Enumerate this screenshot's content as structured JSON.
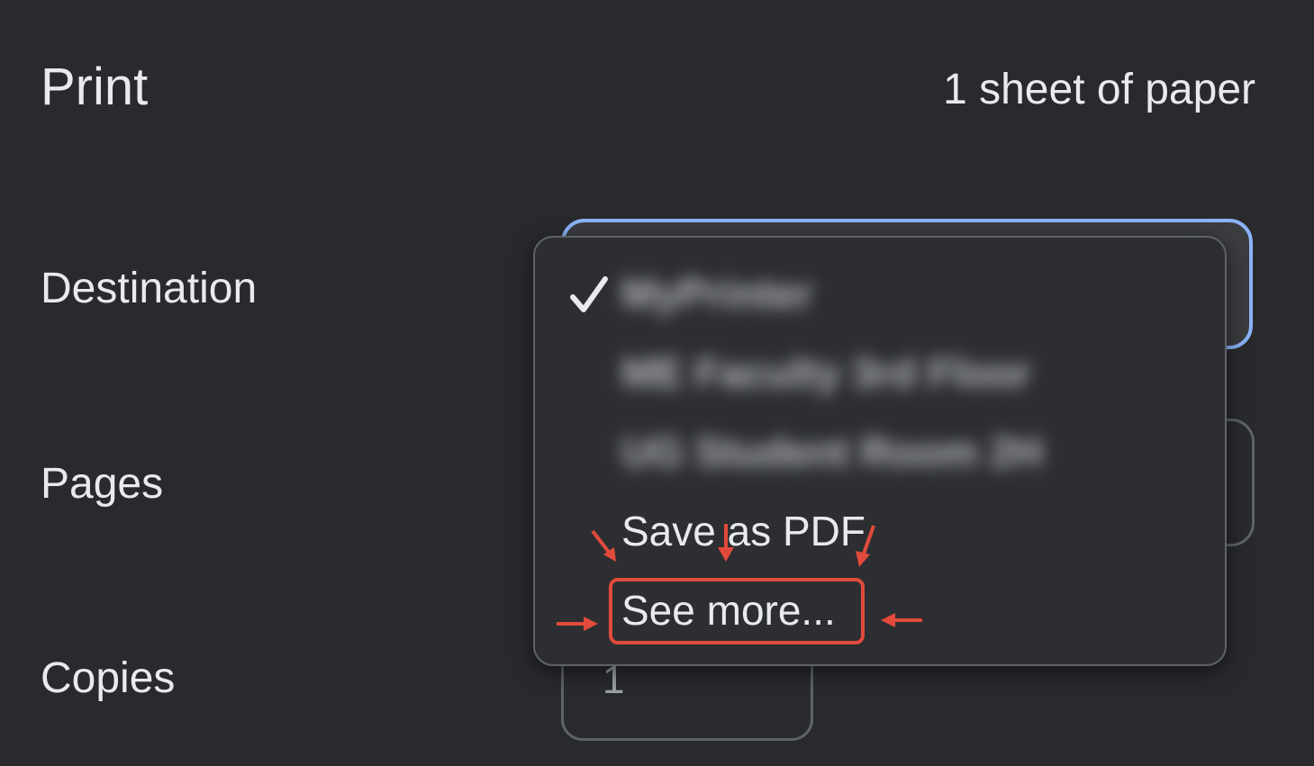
{
  "header": {
    "title": "Print",
    "sheet_count": "1 sheet of paper"
  },
  "settings": {
    "destination_label": "Destination",
    "pages_label": "Pages",
    "copies_label": "Copies",
    "copies_value": "1"
  },
  "destination_dropdown": {
    "selected_index": 0,
    "options": [
      {
        "label": "MyPrinter",
        "blurred": true,
        "checked": true
      },
      {
        "label": "ME Faculty 3rd Floor",
        "blurred": true,
        "checked": false
      },
      {
        "label": "UG Student Room 2H",
        "blurred": true,
        "checked": false
      },
      {
        "label": "Save as PDF",
        "blurred": false,
        "checked": false
      },
      {
        "label": "See more...",
        "blurred": false,
        "checked": false,
        "highlighted": true
      }
    ]
  },
  "annotation": {
    "highlight_color": "#e24a3b",
    "focus_ring_color": "#8ab4f8"
  },
  "icons": {
    "check": "checkmark-icon",
    "arrow": "red-pointer-arrow"
  }
}
